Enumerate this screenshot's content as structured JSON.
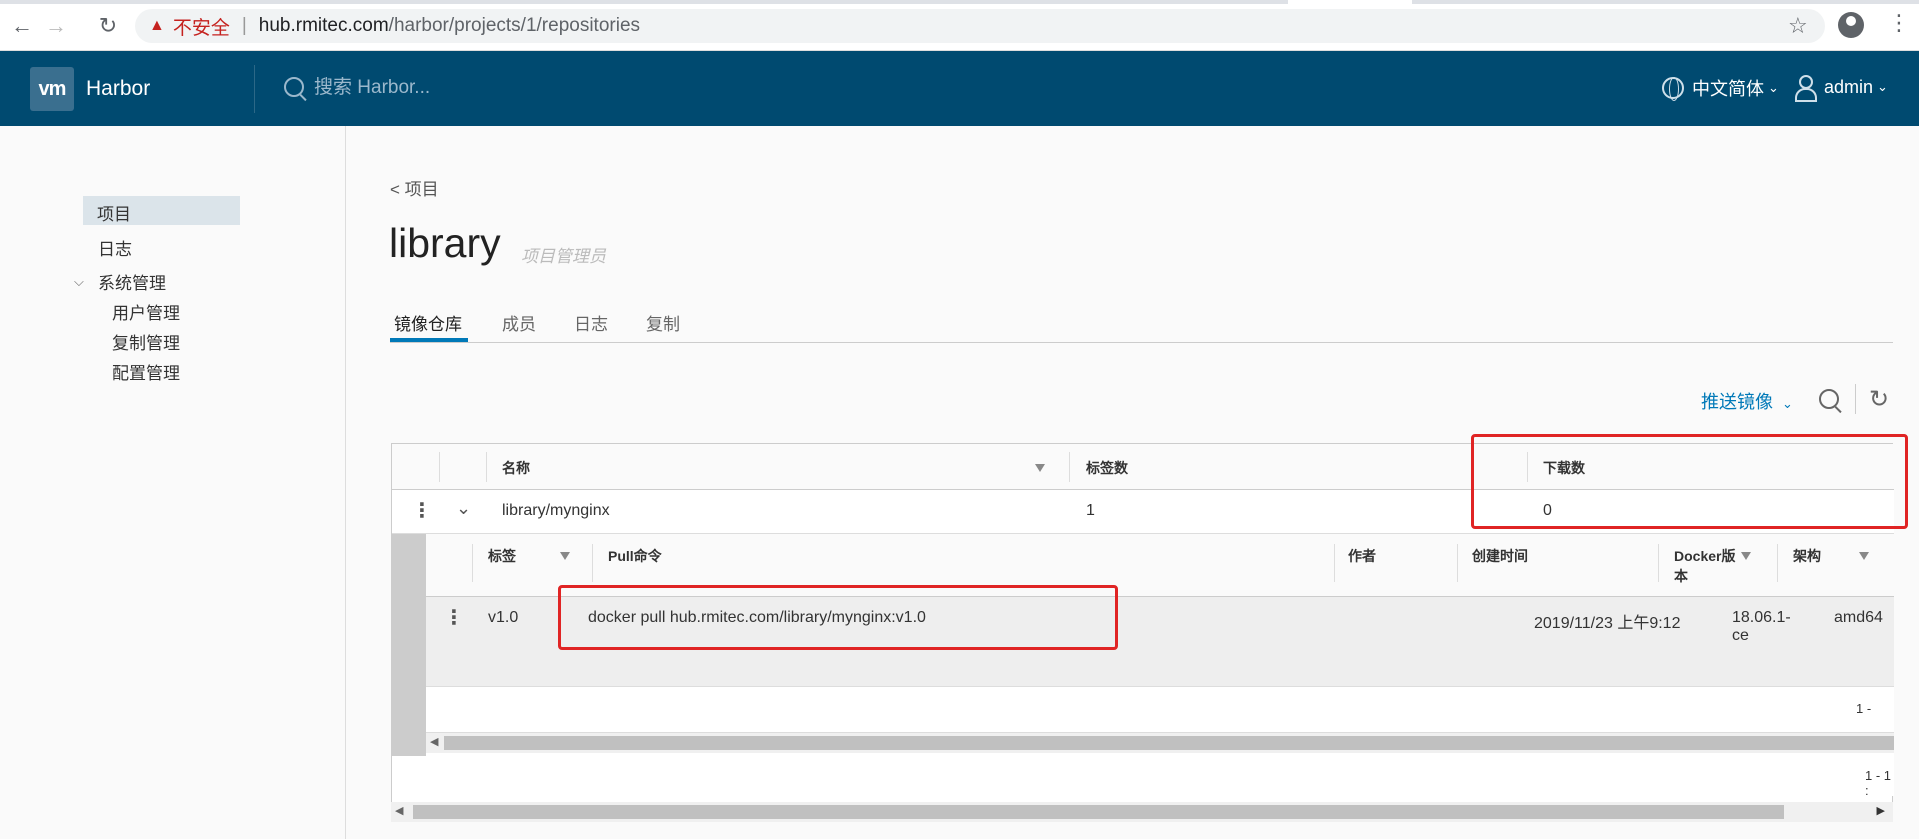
{
  "browser": {
    "warn_symbol": "▲",
    "insecure_label": "不安全",
    "separator": "|",
    "url_host": "hub.rmitec.com",
    "url_path": "/harbor/projects/1/repositories"
  },
  "header": {
    "logo_text": "vm",
    "brand": "Harbor",
    "search_placeholder": "搜索 Harbor...",
    "language": "中文简体",
    "user": "admin"
  },
  "sidebar": {
    "items": [
      {
        "label": "项目"
      },
      {
        "label": "日志"
      },
      {
        "label": "系统管理"
      }
    ],
    "sub_items": [
      {
        "label": "用户管理"
      },
      {
        "label": "复制管理"
      },
      {
        "label": "配置管理"
      }
    ]
  },
  "main": {
    "back_link": "< 项目",
    "title": "library",
    "role": "项目管理员",
    "tabs": [
      {
        "label": "镜像仓库"
      },
      {
        "label": "成员"
      },
      {
        "label": "日志"
      },
      {
        "label": "复制"
      }
    ],
    "push_button": "推送镜像"
  },
  "repo_grid": {
    "columns": [
      "名称",
      "标签数",
      "下载数"
    ],
    "rows": [
      {
        "name": "library/mynginx",
        "tags": "1",
        "pulls": "0"
      }
    ],
    "footer": "1 - 1 :"
  },
  "tag_grid": {
    "columns": [
      "标签",
      "Pull命令",
      "作者",
      "创建时间",
      "Docker版本",
      "架构"
    ],
    "docker_col_line1": "Docker版",
    "docker_col_line2": "本",
    "rows": [
      {
        "tag": "v1.0",
        "pull": "docker pull hub.rmitec.com/library/mynginx:v1.0",
        "author": "",
        "created": "2019/11/23 上午9:12",
        "docker_line1": "18.06.1-",
        "docker_line2": "ce",
        "arch": "amd64"
      }
    ],
    "footer": "1 -"
  },
  "colors": {
    "header_bg": "#004a70",
    "accent": "#0079b8",
    "highlight": "#e02424"
  }
}
